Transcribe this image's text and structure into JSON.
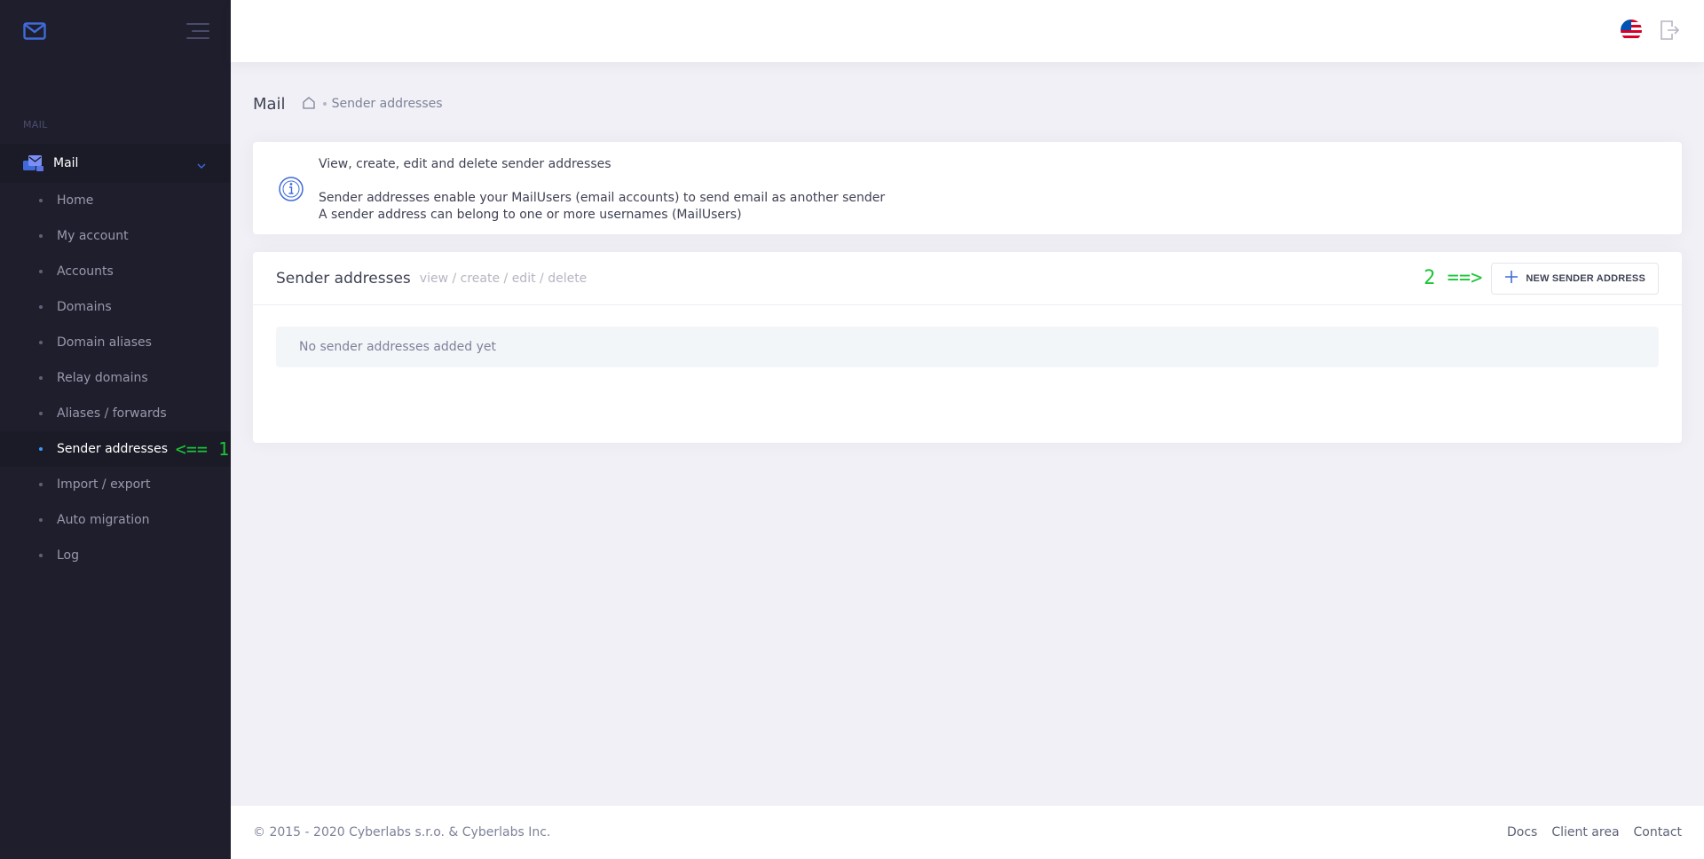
{
  "sidebar": {
    "logo_icon": "envelope-icon",
    "section_label": "MAIL",
    "parent": {
      "label": "Mail",
      "icon": "mail-stack-icon",
      "chevron": "chevron-down-icon"
    },
    "items": [
      {
        "label": "Home"
      },
      {
        "label": "My account"
      },
      {
        "label": "Accounts"
      },
      {
        "label": "Domains"
      },
      {
        "label": "Domain aliases"
      },
      {
        "label": "Relay domains"
      },
      {
        "label": "Aliases / forwards"
      },
      {
        "label": "Sender addresses",
        "active": true
      },
      {
        "label": "Import / export"
      },
      {
        "label": "Auto migration"
      },
      {
        "label": "Log"
      }
    ],
    "annotation": "<== 1"
  },
  "header": {
    "language_icon": "us-flag-icon",
    "logout_icon": "logout-icon"
  },
  "subheader": {
    "title": "Mail",
    "breadcrumb_icon": "home-icon",
    "breadcrumb": "Sender addresses"
  },
  "info": {
    "icon": "info-icon",
    "line1": "View, create, edit and delete sender addresses",
    "line2": "Sender addresses enable your MailUsers (email accounts) to send email as another sender",
    "line3": "A sender address can belong to one or more usernames (MailUsers)"
  },
  "card": {
    "title": "Sender addresses",
    "subtitle": "view / create / edit / delete",
    "annotation": "2 ==>",
    "new_button_label": "NEW SENDER ADDRESS",
    "empty_message": "No sender addresses added yet"
  },
  "footer": {
    "copyright": "© 2015 - 2020 Cyberlabs s.r.o. & Cyberlabs Inc.",
    "links": [
      "Docs",
      "Client area",
      "Contact"
    ]
  },
  "colors": {
    "sidebar_bg": "#1e1e2d",
    "accent": "#3699ff",
    "annotation": "#1bc536",
    "page_bg": "#f0f0f6"
  }
}
